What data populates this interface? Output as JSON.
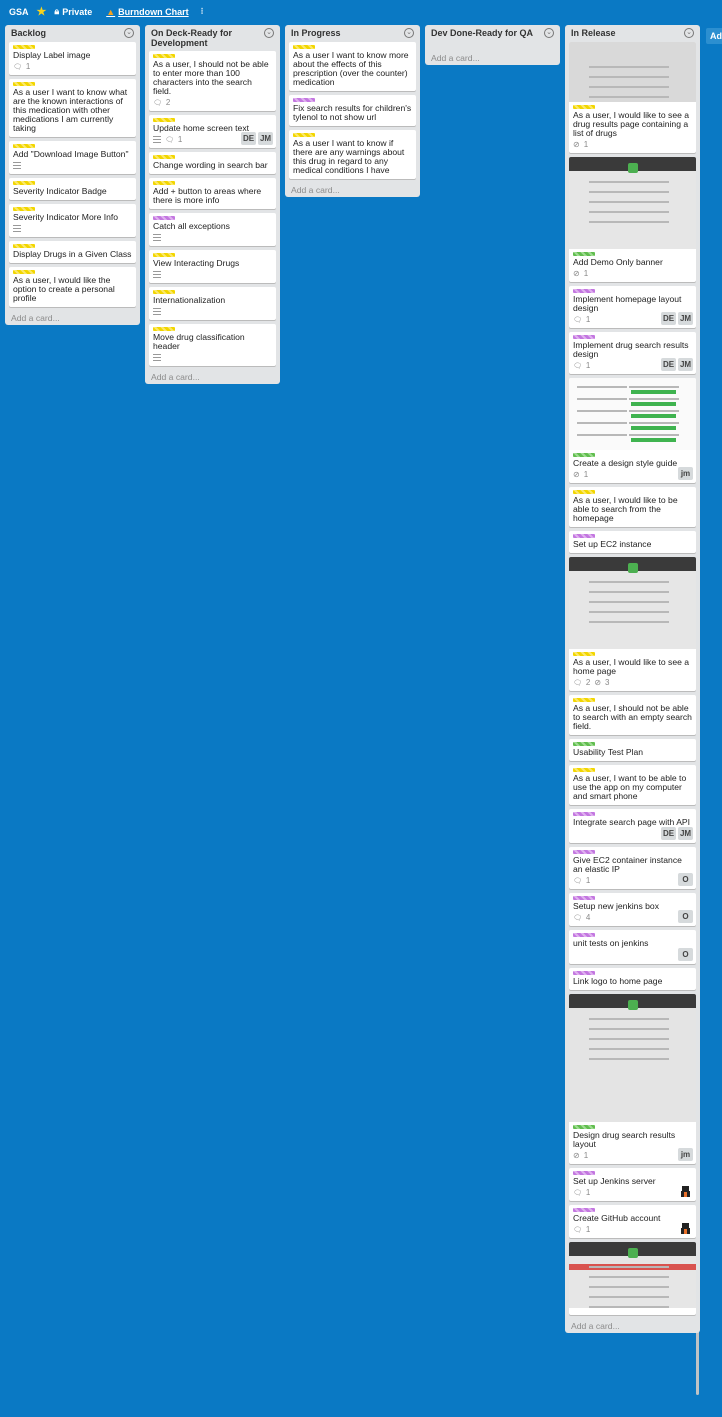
{
  "header": {
    "board_name": "GSA",
    "visibility": "Private",
    "burndown": "Burndown Chart",
    "menu": "⁝"
  },
  "side_button": "Ad",
  "lists": [
    {
      "title": "Backlog",
      "add": "Add a card...",
      "cards": [
        {
          "labels": [
            "yellow"
          ],
          "title": "Display Label image",
          "comments": "1"
        },
        {
          "labels": [
            "yellow"
          ],
          "title": "As a user I want to know what are the known interactions of this medication with other medications I am currently taking"
        },
        {
          "labels": [
            "yellow"
          ],
          "title": "Add \"Download Image Button\"",
          "desc": true
        },
        {
          "labels": [
            "yellow"
          ],
          "title": "Severity Indicator Badge"
        },
        {
          "labels": [
            "yellow"
          ],
          "title": "Severity Indicator More Info",
          "desc": true
        },
        {
          "labels": [
            "yellow"
          ],
          "title": "Display Drugs in a Given Class"
        },
        {
          "labels": [
            "yellow"
          ],
          "title": "As a user, I would like the option to create a personal profile"
        }
      ]
    },
    {
      "title": "On Deck-Ready for Development",
      "add": "Add a card...",
      "cards": [
        {
          "labels": [
            "yellow"
          ],
          "title": "As a user, I should not be able to enter more than 100 characters into the search field.",
          "comments": "2"
        },
        {
          "labels": [
            "yellow"
          ],
          "title": "Update home screen text",
          "desc": true,
          "comments": "1",
          "members": [
            "DE",
            "JM"
          ]
        },
        {
          "labels": [
            "yellow"
          ],
          "title": "Change wording in search bar"
        },
        {
          "labels": [
            "yellow"
          ],
          "title": "Add + button to areas where there is more info"
        },
        {
          "labels": [
            "purple"
          ],
          "title": "Catch all exceptions",
          "desc": true
        },
        {
          "labels": [
            "yellow"
          ],
          "title": "View Interacting Drugs",
          "desc": true
        },
        {
          "labels": [
            "yellow"
          ],
          "title": "Internationalization",
          "desc": true
        },
        {
          "labels": [
            "yellow"
          ],
          "title": "Move drug classification header",
          "desc": true
        }
      ]
    },
    {
      "title": "In Progress",
      "add": "Add a card...",
      "cards": [
        {
          "labels": [
            "yellow"
          ],
          "title": "As a user I want to know more about the effects of this prescription (over the counter) medication"
        },
        {
          "labels": [
            "purple"
          ],
          "title": "Fix search results for children's tylenol to not show url"
        },
        {
          "labels": [
            "yellow"
          ],
          "title": "As a user I want to know if there are any warnings about this drug in regard to any medical conditions I have"
        }
      ]
    },
    {
      "title": "Dev Done-Ready for QA",
      "add": "Add a card...",
      "cards": []
    },
    {
      "title": "In Release",
      "add": "Add a card...",
      "cards": [
        {
          "cover": "top",
          "labels": [
            "yellow"
          ],
          "title": "As a user, I would like to see a drug results page containing a list of drugs",
          "attach": "1"
        },
        {
          "cover": "full",
          "labels": [
            "green"
          ],
          "title": "Add Demo Only banner",
          "attach": "1"
        },
        {
          "labels": [
            "purple"
          ],
          "title": "Implement homepage layout design",
          "comments": "1",
          "members": [
            "DE",
            "JM"
          ]
        },
        {
          "labels": [
            "purple"
          ],
          "title": "Implement drug search results design",
          "comments": "1",
          "members": [
            "DE",
            "JM"
          ]
        },
        {
          "cover": "guide",
          "labels": [
            "green"
          ],
          "title": "Create a design style guide",
          "attach": "1",
          "members": [
            "jm"
          ]
        },
        {
          "labels": [
            "yellow"
          ],
          "title": "As a user, I would like to be able to search from the homepage"
        },
        {
          "labels": [
            "purple"
          ],
          "title": "Set up EC2 instance"
        },
        {
          "cover": "full",
          "labels": [
            "yellow"
          ],
          "title": "As a user, I would like to see a home page",
          "comments": "2",
          "attach": "3"
        },
        {
          "labels": [
            "yellow"
          ],
          "title": "As a user, I should not be able to search with an empty search field."
        },
        {
          "labels": [
            "green"
          ],
          "title": "Usability Test Plan"
        },
        {
          "labels": [
            "yellow"
          ],
          "title": "As a user, I want to be able to use the app on my computer and smart phone"
        },
        {
          "labels": [
            "purple"
          ],
          "title": "Integrate search page with API",
          "members": [
            "DE",
            "JM"
          ]
        },
        {
          "labels": [
            "purple"
          ],
          "title": "Give EC2 container instance an elastic IP",
          "comments": "1",
          "members": [
            "O"
          ]
        },
        {
          "labels": [
            "purple"
          ],
          "title": "Setup new jenkins box",
          "comments": "4",
          "members": [
            "O"
          ]
        },
        {
          "labels": [
            "purple"
          ],
          "title": "unit tests on jenkins",
          "members": [
            "O"
          ]
        },
        {
          "labels": [
            "purple"
          ],
          "title": "Link logo to home page"
        },
        {
          "cover": "tall",
          "labels": [
            "green"
          ],
          "title": "Design drug search results layout",
          "attach": "1",
          "members": [
            "jm"
          ]
        },
        {
          "labels": [
            "purple"
          ],
          "title": "Set up Jenkins server",
          "comments": "1",
          "members": [
            "avatar"
          ]
        },
        {
          "labels": [
            "purple"
          ],
          "title": "Create GitHub account",
          "comments": "1",
          "members": [
            "avatar"
          ]
        },
        {
          "cover": "partial",
          "labels": [],
          "title": ""
        }
      ]
    }
  ]
}
